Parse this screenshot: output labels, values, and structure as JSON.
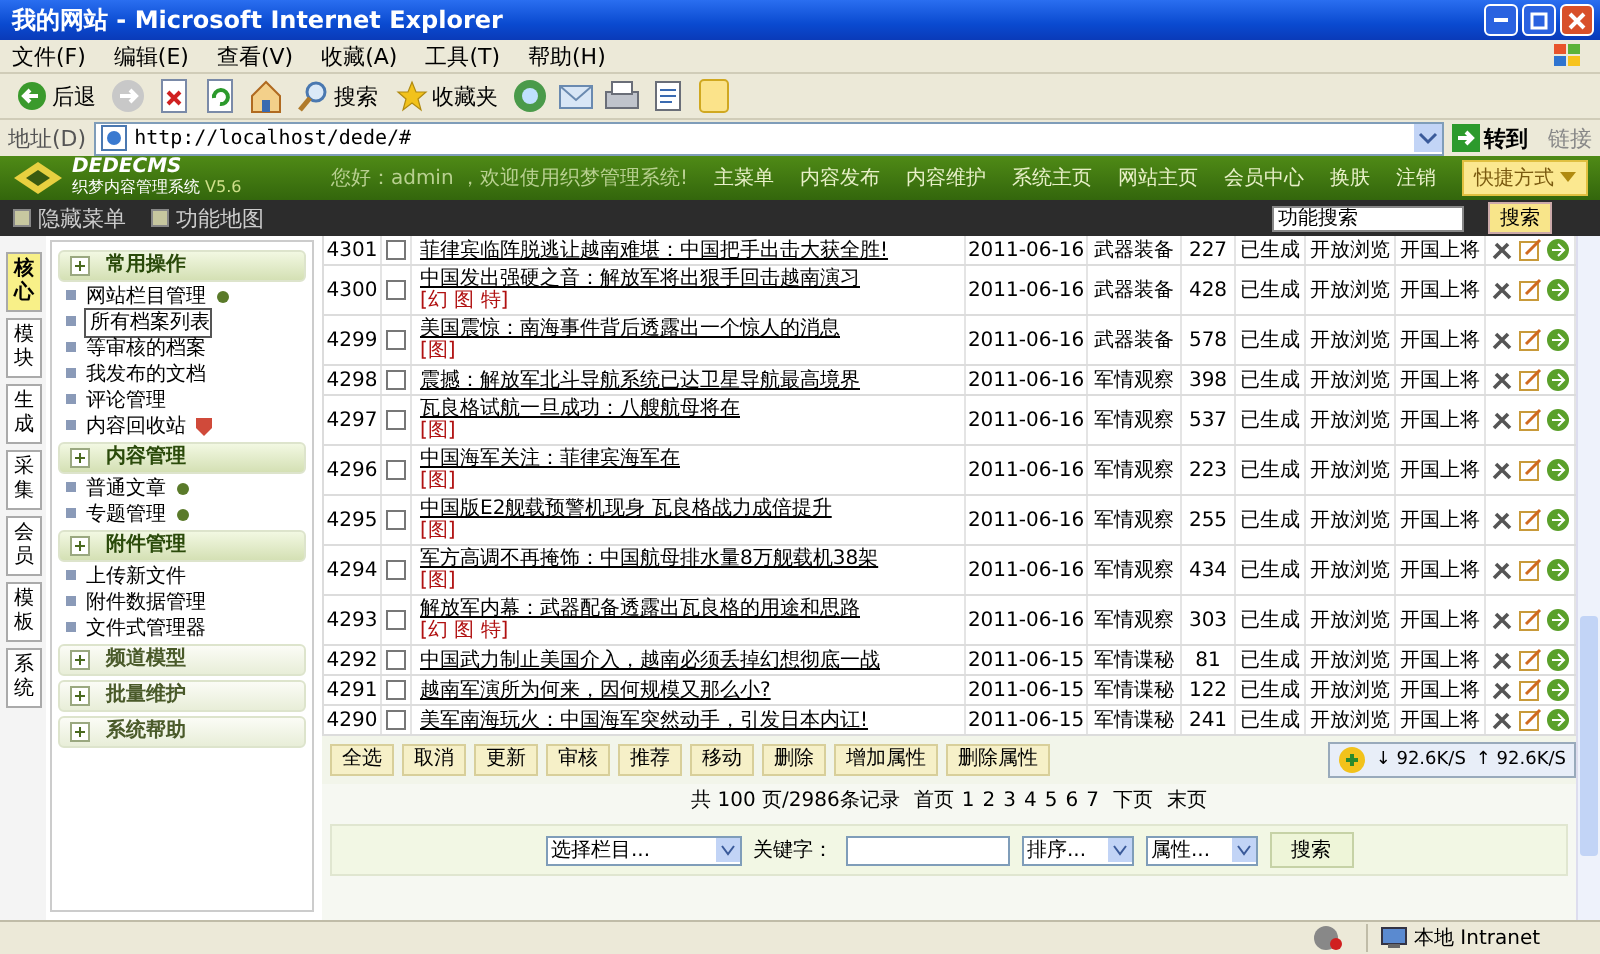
{
  "window": {
    "title": "我的网站 - Microsoft Internet Explorer"
  },
  "menu": [
    "文件(F)",
    "编辑(E)",
    "查看(V)",
    "收藏(A)",
    "工具(T)",
    "帮助(H)"
  ],
  "toolbar": [
    {
      "kind": "back",
      "label": "后退"
    },
    {
      "kind": "forward"
    },
    {
      "kind": "stop"
    },
    {
      "kind": "refresh"
    },
    {
      "kind": "home"
    },
    {
      "kind": "search",
      "label": "搜索"
    },
    {
      "kind": "favorites",
      "label": "收藏夹"
    },
    {
      "kind": "media"
    },
    {
      "kind": "mail"
    },
    {
      "kind": "print"
    },
    {
      "kind": "edit"
    },
    {
      "kind": "note"
    }
  ],
  "address_bar": {
    "label": "地址(D)",
    "url": "http://localhost/dede/#",
    "go": "转到",
    "links": "链接"
  },
  "app_header": {
    "logo": "DEDECMS",
    "subtitle": "织梦内容管理系统",
    "version": "V5.6",
    "greeting": "您好：admin ，欢迎使用织梦管理系统!",
    "nav": [
      "主菜单",
      "内容发布",
      "内容维护",
      "系统主页",
      "网站主页",
      "会员中心",
      "换肤",
      "注销"
    ],
    "shortcut": "快捷方式"
  },
  "sub_bar": {
    "links": [
      "隐藏菜单",
      "功能地图"
    ],
    "search_value": "功能搜索",
    "search_button": "搜索"
  },
  "side_tabs": [
    {
      "label": "核心",
      "selected": true
    },
    {
      "label": "模块",
      "selected": false
    },
    {
      "label": "生成",
      "selected": false
    },
    {
      "label": "采集",
      "selected": false
    },
    {
      "label": "会员",
      "selected": false
    },
    {
      "label": "模板",
      "selected": false
    },
    {
      "label": "系统",
      "selected": false
    }
  ],
  "sidebar": [
    {
      "title": "常用操作",
      "expanded": true,
      "items": [
        {
          "label": "网站栏目管理",
          "kind": "add",
          "selected": false
        },
        {
          "label": "所有档案列表",
          "kind": "plain",
          "selected": true
        },
        {
          "label": "等审核的档案",
          "kind": "plain",
          "selected": false
        },
        {
          "label": "我发布的文档",
          "kind": "plain",
          "selected": false
        },
        {
          "label": "评论管理",
          "kind": "plain",
          "selected": false
        },
        {
          "label": "内容回收站",
          "kind": "recycle",
          "selected": false
        }
      ]
    },
    {
      "title": "内容管理",
      "expanded": true,
      "items": [
        {
          "label": "普通文章",
          "kind": "add",
          "selected": false
        },
        {
          "label": "专题管理",
          "kind": "add",
          "selected": false
        }
      ]
    },
    {
      "title": "附件管理",
      "expanded": true,
      "items": [
        {
          "label": "上传新文件",
          "kind": "plain",
          "selected": false
        },
        {
          "label": "附件数据管理",
          "kind": "plain",
          "selected": false
        },
        {
          "label": "文件式管理器",
          "kind": "plain",
          "selected": false
        }
      ]
    },
    {
      "title": "频道模型",
      "expanded": false
    },
    {
      "title": "批量维护",
      "expanded": false
    },
    {
      "title": "系统帮助",
      "expanded": false
    }
  ],
  "table": {
    "rows": [
      {
        "id": "4301",
        "checked": false,
        "title": "菲律宾临阵脱逃让越南难堪：中国把手出击大获全胜!",
        "date": "2011-06-16",
        "category": "武器装备",
        "clicks": "227",
        "status": "已生成",
        "access": "开放浏览",
        "author": "开国上将"
      },
      {
        "id": "4300",
        "checked": false,
        "title": "中国发出强硬之音：解放军将出狠手回击越南演习",
        "flags": "[幻 图 特]",
        "date": "2011-06-16",
        "category": "武器装备",
        "clicks": "428",
        "status": "已生成",
        "access": "开放浏览",
        "author": "开国上将"
      },
      {
        "id": "4299",
        "checked": false,
        "title": "美国震惊：南海事件背后透露出一个惊人的消息",
        "flags": "[图]",
        "date": "2011-06-16",
        "category": "武器装备",
        "clicks": "578",
        "status": "已生成",
        "access": "开放浏览",
        "author": "开国上将"
      },
      {
        "id": "4298",
        "checked": false,
        "title": "震撼：解放军北斗导航系统已达卫星导航最高境界",
        "date": "2011-06-16",
        "category": "军情观察",
        "clicks": "398",
        "status": "已生成",
        "access": "开放浏览",
        "author": "开国上将"
      },
      {
        "id": "4297",
        "checked": false,
        "title": "瓦良格试航一旦成功：八艘航母将在",
        "flags": "[图]",
        "date": "2011-06-16",
        "category": "军情观察",
        "clicks": "537",
        "status": "已生成",
        "access": "开放浏览",
        "author": "开国上将"
      },
      {
        "id": "4296",
        "checked": false,
        "title": "中国海军关注：菲律宾海军在",
        "flags": "[图]",
        "date": "2011-06-16",
        "category": "军情观察",
        "clicks": "223",
        "status": "已生成",
        "access": "开放浏览",
        "author": "开国上将"
      },
      {
        "id": "4295",
        "checked": false,
        "title": "中国版E2舰载预警机现身 瓦良格战力成倍提升",
        "flags": "[图]",
        "date": "2011-06-16",
        "category": "军情观察",
        "clicks": "255",
        "status": "已生成",
        "access": "开放浏览",
        "author": "开国上将"
      },
      {
        "id": "4294",
        "checked": false,
        "title": "军方高调不再掩饰：中国航母排水量8万舰载机38架",
        "flags": "[图]",
        "date": "2011-06-16",
        "category": "军情观察",
        "clicks": "434",
        "status": "已生成",
        "access": "开放浏览",
        "author": "开国上将"
      },
      {
        "id": "4293",
        "checked": false,
        "title": "解放军内幕：武器配备透露出瓦良格的用途和思路",
        "flags": "[幻 图 特]",
        "date": "2011-06-16",
        "category": "军情观察",
        "clicks": "303",
        "status": "已生成",
        "access": "开放浏览",
        "author": "开国上将"
      },
      {
        "id": "4292",
        "checked": false,
        "title": "中国武力制止美国介入，越南必须丢掉幻想彻底一战",
        "date": "2011-06-15",
        "category": "军情谍秘",
        "clicks": "81",
        "status": "已生成",
        "access": "开放浏览",
        "author": "开国上将"
      },
      {
        "id": "4291",
        "checked": false,
        "title": "越南军演所为何来，因何规模又那么小?",
        "date": "2011-06-15",
        "category": "军情谍秘",
        "clicks": "122",
        "status": "已生成",
        "access": "开放浏览",
        "author": "开国上将"
      },
      {
        "id": "4290",
        "checked": false,
        "title": "美军南海玩火：中国海军突然动手，引发日本内讧!",
        "date": "2011-06-15",
        "category": "军情谍秘",
        "clicks": "241",
        "status": "已生成",
        "access": "开放浏览",
        "author": "开国上将"
      }
    ]
  },
  "actions": [
    "全选",
    "取消",
    "更新",
    "审核",
    "推荐",
    "移动",
    "删除",
    "增加属性",
    "删除属性"
  ],
  "pagination": {
    "summary": "共 100 页/2986条记录",
    "first": "首页",
    "pages": [
      "1",
      "2",
      "3",
      "4",
      "5",
      "6",
      "7"
    ],
    "next": "下页",
    "last": "末页"
  },
  "search": {
    "category": "选择栏目...",
    "keyword_label": "关键字：",
    "order": "排序...",
    "attribute": "属性...",
    "button": "搜索"
  },
  "speed_widget": {
    "down": "↓ 92.6K/S",
    "up": "↑ 92.6K/S"
  },
  "status_bar": {
    "zone": "本地 Intranet"
  }
}
